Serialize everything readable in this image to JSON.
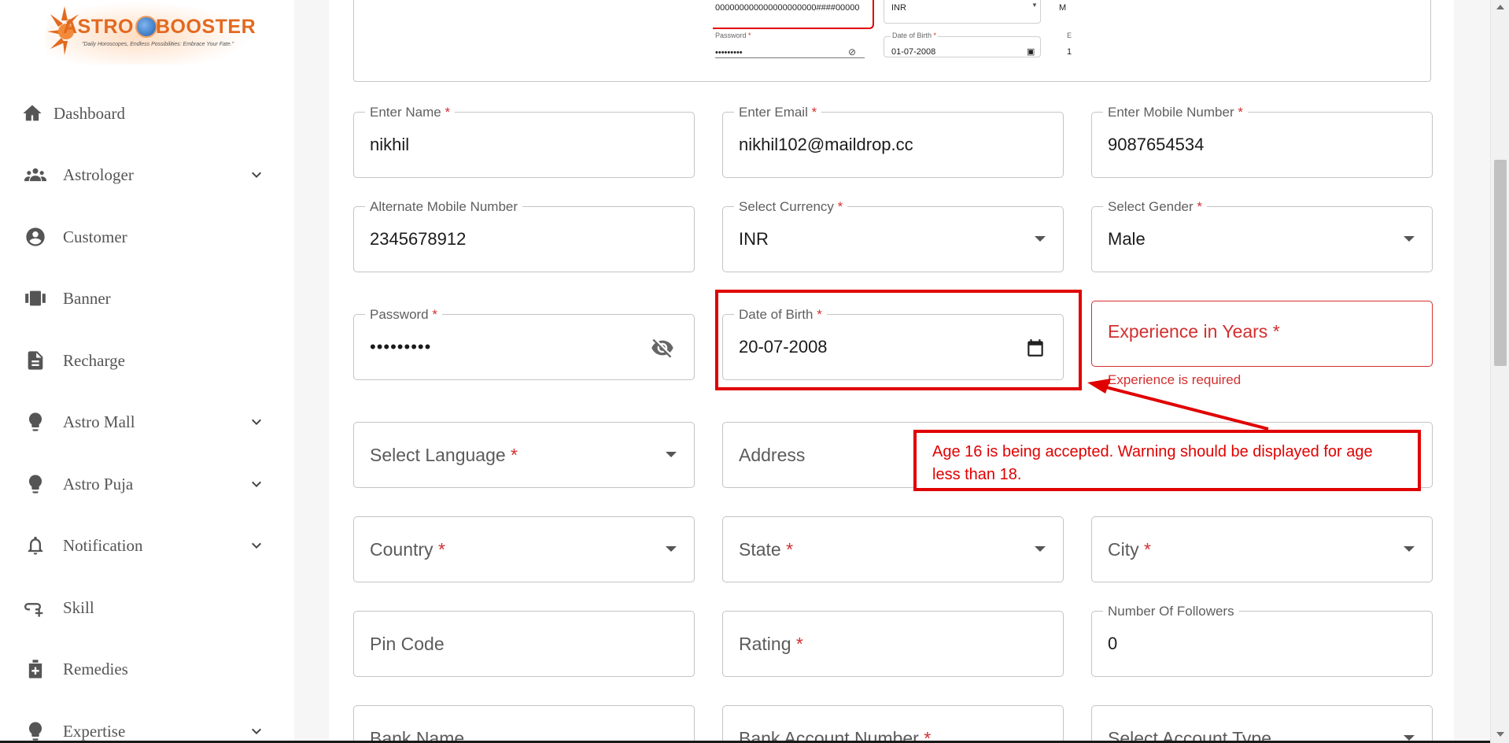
{
  "brand": {
    "name_left": "ASTRO",
    "name_right": "BOOSTER",
    "tagline": "\"Daily Horoscopes, Endless Possibilities: Embrace Your Fate.\""
  },
  "sidebar": {
    "items": [
      {
        "label": "Dashboard",
        "icon": "home-icon",
        "expandable": false
      },
      {
        "label": "Astrologer",
        "icon": "users-icon",
        "expandable": true
      },
      {
        "label": "Customer",
        "icon": "user-circle-icon",
        "expandable": false
      },
      {
        "label": "Banner",
        "icon": "banner-icon",
        "expandable": false
      },
      {
        "label": "Recharge",
        "icon": "document-icon",
        "expandable": false
      },
      {
        "label": "Astro Mall",
        "icon": "bulb-icon",
        "expandable": true
      },
      {
        "label": "Astro Puja",
        "icon": "bulb-icon",
        "expandable": true
      },
      {
        "label": "Notification",
        "icon": "bell-icon",
        "expandable": true
      },
      {
        "label": "Skill",
        "icon": "skill-icon",
        "expandable": false
      },
      {
        "label": "Remedies",
        "icon": "medical-box-icon",
        "expandable": false
      },
      {
        "label": "Expertise",
        "icon": "bulb-icon",
        "expandable": true
      }
    ]
  },
  "preview": {
    "text_value": "000000000000000000000####00000",
    "currency_value": "INR",
    "truncated_value": "M",
    "password_label": "Password",
    "password_value": "•••••••••",
    "dob_label": "Date of Birth",
    "dob_value": "01-07-2008",
    "edge_label": "E",
    "edge_value": "1"
  },
  "form": {
    "name": {
      "label": "Enter Name",
      "value": "nikhil"
    },
    "email": {
      "label": "Enter Email",
      "value": "nikhil102@maildrop.cc"
    },
    "mobile": {
      "label": "Enter Mobile Number",
      "value": "9087654534"
    },
    "alt_mobile": {
      "label": "Alternate Mobile Number",
      "value": "2345678912"
    },
    "currency": {
      "label": "Select Currency",
      "value": "INR"
    },
    "gender": {
      "label": "Select Gender",
      "value": "Male"
    },
    "password": {
      "label": "Password",
      "value": "•••••••••"
    },
    "dob": {
      "label": "Date of Birth",
      "value": "20-07-2008"
    },
    "experience": {
      "placeholder": "Experience in Years",
      "error": "Experience is required"
    },
    "language": {
      "placeholder": "Select Language"
    },
    "address": {
      "placeholder": "Address"
    },
    "country": {
      "placeholder": "Country"
    },
    "state": {
      "placeholder": "State"
    },
    "city": {
      "placeholder": "City"
    },
    "pin": {
      "placeholder": "Pin Code"
    },
    "rating": {
      "placeholder": "Rating"
    },
    "followers": {
      "label": "Number Of Followers",
      "value": "0"
    },
    "bank_name": {
      "placeholder": "Bank Name"
    },
    "bank_account": {
      "placeholder": "Bank Account Number"
    },
    "account_type": {
      "placeholder": "Select Account Type"
    },
    "required_mark": "*"
  },
  "annotation": {
    "note": "Age 16 is being accepted. Warning should be displayed for age less than 18.",
    "color": "#e00000"
  },
  "colors": {
    "error": "#d32f2f",
    "brand": "#e2691f"
  }
}
